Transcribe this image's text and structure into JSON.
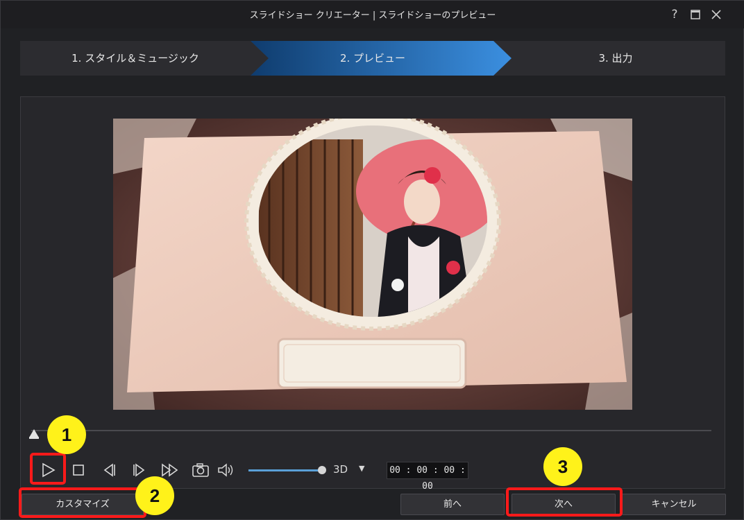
{
  "window": {
    "title": "スライドショー クリエーター | スライドショーのプレビュー"
  },
  "window_controls": {
    "help_glyph": "?",
    "help_icon": "question-mark-icon",
    "maximize_icon": "maximize-icon",
    "close_icon": "close-icon"
  },
  "steps": [
    {
      "label": "1. スタイル＆ミュージック",
      "active": false
    },
    {
      "label": "2. プレビュー",
      "active": true
    },
    {
      "label": "3. 出力",
      "active": false
    }
  ],
  "preview": {
    "playback_position": 0
  },
  "controls": {
    "play_icon": "play-icon",
    "stop_icon": "stop-icon",
    "prev_frame_icon": "previous-frame-icon",
    "next_frame_icon": "next-frame-icon",
    "fast_forward_icon": "fast-forward-icon",
    "snapshot_icon": "camera-icon",
    "volume_icon": "speaker-icon",
    "volume_level": 1.0,
    "mode_3d_label": "3D",
    "mode_3d_dropdown_glyph": "▼",
    "timecode": "00 : 00 : 00 : 00"
  },
  "buttons": {
    "customize": "カスタマイズ",
    "back": "前へ",
    "next": "次へ",
    "cancel": "キャンセル"
  },
  "annotations": {
    "marker_1": "1",
    "marker_2": "2",
    "marker_3": "3",
    "marker_color": "#fff21a",
    "highlight_color": "#ff1a1a"
  },
  "colors": {
    "accent": "#2b7fd0",
    "background": "#202124"
  }
}
